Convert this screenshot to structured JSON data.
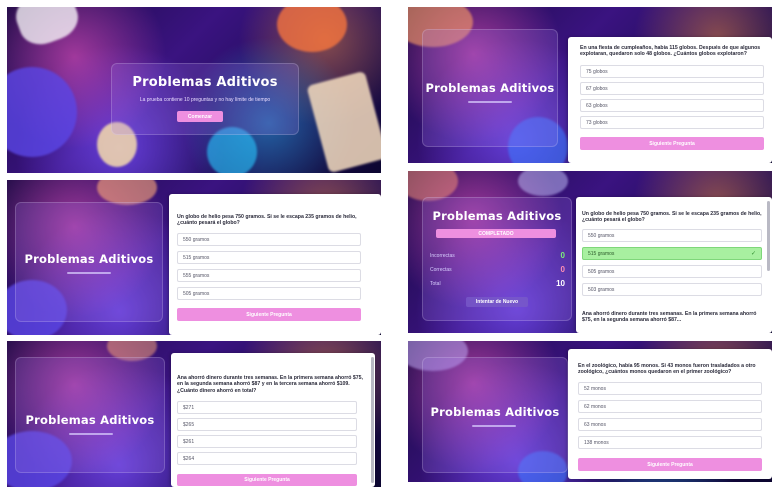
{
  "app_title": "Problemas Aditivos",
  "intro": {
    "subtitle": "La prueba contiene 10 preguntas y no hay límite de tiempo",
    "start_button": "Comenzar"
  },
  "next_button": "Siguiente Pregunta",
  "q_birthday": {
    "question": "En una fiesta de cumpleaños, había 115 globos. Después de que algunos explotaran, quedaron solo 48 globos. ¿Cuántos globos explotaron?",
    "options": [
      "75 globos",
      "67 globos",
      "63 globos",
      "73 globos"
    ]
  },
  "q_balloon": {
    "question": "Un globo de helio pesa 750 gramos. Si se le escapa 235 gramos de helio, ¿cuánto pesará el globo?",
    "options": [
      "550 gramos",
      "515 gramos",
      "555 gramos",
      "505 gramos"
    ]
  },
  "q_balloon_result": {
    "options": [
      "550 gramos",
      "515 gramos",
      "505 gramos",
      "503 gramos"
    ],
    "correct_index": 1,
    "completed_label": "COMPLETADO",
    "stats": [
      {
        "label": "Incorrectas",
        "value": "0",
        "color": "#7df27a"
      },
      {
        "label": "Correctas",
        "value": "0",
        "color": "#ff8fb4"
      },
      {
        "label": "Total",
        "value": "10",
        "color": "#ffffff"
      }
    ],
    "retry_button": "Intentar de Nuevo",
    "next_question_preview": "Ana ahorró dinero durante tres semanas. En la primera semana ahorró $75, en la segunda semana ahorró $87..."
  },
  "q_savings": {
    "question": "Ana ahorró dinero durante tres semanas. En la primera semana ahorró $75, en la segunda semana ahorró $87 y en la tercera semana ahorró $109. ¿Cuánto dinero ahorró en total?",
    "options": [
      "$271",
      "$265",
      "$261",
      "$264"
    ]
  },
  "q_zoo": {
    "question": "En el zoológico, había 95 monos. Si 43 monos fueron trasladados a otro zoológico, ¿cuántos monos quedaron en el primer zoológico?",
    "options": [
      "52 monos",
      "62 monos",
      "63 monos",
      "138 monos"
    ]
  },
  "colors": {
    "accent_pink": "#ee8fe0",
    "correct_green": "#a8f0a0",
    "scene_purple": "#3a1380"
  }
}
